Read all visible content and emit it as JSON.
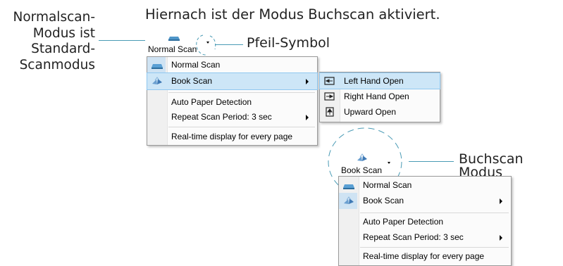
{
  "captions": {
    "top": "Hiernach ist der Modus Buchscan aktiviert.",
    "left_lines": [
      "Normalscan-",
      "Modus ist",
      "Standard-",
      "Scanmodus"
    ],
    "arrow_symbol": "Pfeil-Symbol",
    "book_mode": "Buchscan Modus"
  },
  "colors": {
    "callout_line": "#4a9bb5",
    "highlight": "#cde6f7",
    "highlight_border": "#90c8f0"
  },
  "top_example": {
    "button_label": "Normal Scan",
    "menu": [
      {
        "label": "Normal Scan",
        "icon": "scanner-icon",
        "submenu": false,
        "checked": true
      },
      {
        "label": "Book Scan",
        "icon": "book-icon",
        "submenu": true,
        "highlighted": true
      },
      {
        "label": "Auto Paper Detection"
      },
      {
        "label": "Repeat Scan Period:  3 sec",
        "submenu": true
      },
      {
        "label": "Real-time display for every page"
      }
    ],
    "submenu": [
      {
        "label": "Left Hand Open",
        "icon": "left-hand-open-icon",
        "highlighted": true
      },
      {
        "label": "Right Hand Open",
        "icon": "right-hand-open-icon"
      },
      {
        "label": "Upward Open",
        "icon": "upward-open-icon"
      }
    ]
  },
  "bottom_example": {
    "button_label": "Book Scan",
    "menu": [
      {
        "label": "Normal Scan",
        "icon": "scanner-icon"
      },
      {
        "label": "Book Scan",
        "icon": "book-icon",
        "submenu": true,
        "checked": true
      },
      {
        "label": "Auto Paper Detection"
      },
      {
        "label": "Repeat Scan Period:  3 sec",
        "submenu": true
      },
      {
        "label": "Real-time display for every page"
      }
    ]
  }
}
